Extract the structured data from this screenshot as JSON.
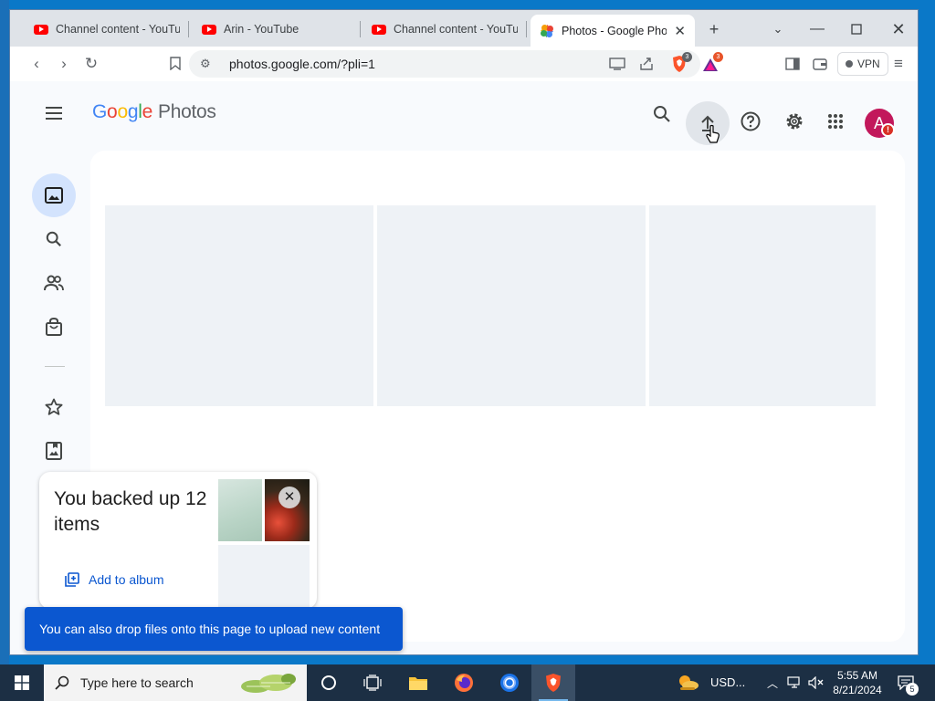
{
  "browser": {
    "tabs": [
      {
        "title": "Channel content - YouTube",
        "active": false,
        "favicon": "youtube-icon"
      },
      {
        "title": "Arin - YouTube",
        "active": false,
        "favicon": "youtube-icon"
      },
      {
        "title": "Channel content - YouTube",
        "active": false,
        "favicon": "youtube-icon"
      },
      {
        "title": "Photos - Google Photos",
        "active": true,
        "favicon": "google-photos-icon"
      }
    ],
    "url": "photos.google.com/?pli=1",
    "vpn_label": "VPN",
    "brave_shield_count": "3",
    "rewards_count": "3"
  },
  "app": {
    "logo_google": [
      "G",
      "o",
      "o",
      "g",
      "l",
      "e"
    ],
    "logo_product": "Photos",
    "avatar_letter": "A",
    "avatar_alert": "!"
  },
  "card": {
    "title": "You backed up 12 items",
    "add_to_album_label": "Add to album",
    "close_label": "✕"
  },
  "snackbar": {
    "message": "You can also drop files onto this page to upload new content"
  },
  "taskbar": {
    "search_placeholder": "Type here to search",
    "weather_label": "USD...",
    "time": "5:55 AM",
    "date": "8/21/2024",
    "notification_count": "5"
  },
  "colors": {
    "accent": "#0b57d0",
    "rail_active": "#d3e3fd",
    "avatar": "#c2185b"
  }
}
